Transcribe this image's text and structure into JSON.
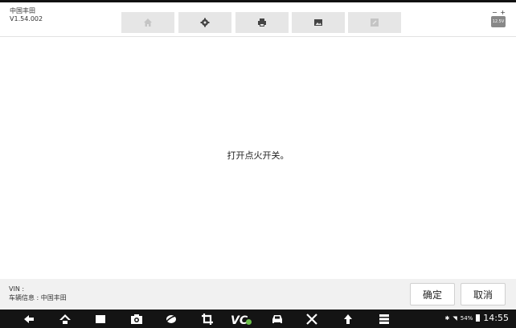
{
  "header": {
    "vehicle_name": "中国丰田",
    "software_version": "V1.54.002",
    "battery_voltage": "12.5V",
    "toolbar_icons": [
      "home-icon",
      "gear-icon",
      "printer-icon",
      "image-icon",
      "edit-icon"
    ]
  },
  "main": {
    "message": "打开点火开关。"
  },
  "footer": {
    "vin_label": "VIN :",
    "vehicle_info": "车辆信息 : 中国丰田",
    "confirm_label": "确定",
    "cancel_label": "取消"
  },
  "navbar": {
    "icons": [
      "back-icon",
      "home-icon",
      "recent-apps-icon",
      "camera-icon",
      "browser-icon",
      "crop-icon",
      "vci-icon",
      "car-icon",
      "tools-icon",
      "upload-icon",
      "menu-icon"
    ],
    "vci_label": "VC",
    "battery_percent": "54%",
    "time": "14:55"
  },
  "colors": {
    "toolbar_button": "#e6e6e6",
    "footer_bg": "#f1f1f1",
    "navbar_bg": "#141414",
    "vci_status": "#6cc04a"
  }
}
